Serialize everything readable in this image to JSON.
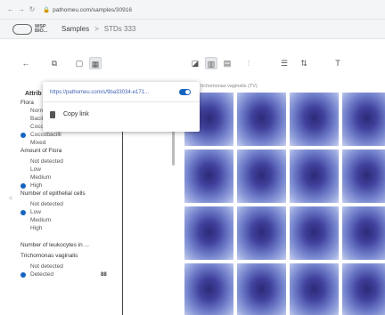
{
  "browser": {
    "url": "pathomeu.com/samples/30916",
    "back_icon": "arrow-left-icon",
    "forward_icon": "arrow-right-icon",
    "reload_icon": "reload-icon"
  },
  "header": {
    "logo_text": "WSP BIO...",
    "breadcrumb_root": "Samples",
    "breadcrumb_sep": ">",
    "breadcrumb_current": "STDs 333"
  },
  "toolbar": {
    "icons": [
      "back-arrow-icon",
      "share-icon",
      "document-icon",
      "grid-view-icon",
      "layout-a-icon",
      "layout-b-icon",
      "layout-c-icon",
      "column-icon",
      "filter-icon",
      "sort-icon",
      "text-size-icon"
    ]
  },
  "popup": {
    "share_url": "https://pathomeu.com/s/9ba33034-e171...",
    "copy_label": "Copy link"
  },
  "sidebar": {
    "heading": "Attrib",
    "items": [
      {
        "text": "Flora",
        "kind": "group"
      },
      {
        "text": "Normal",
        "kind": "opt"
      },
      {
        "text": "Bacilli",
        "kind": "opt"
      },
      {
        "text": "Cocci",
        "kind": "opt"
      },
      {
        "text": "Coccobacilli",
        "kind": "opt",
        "selected": true
      },
      {
        "text": "Mixed",
        "kind": "opt"
      },
      {
        "text": "Amount of Flora",
        "kind": "group"
      },
      {
        "text": "Not detected",
        "kind": "opt"
      },
      {
        "text": "Low",
        "kind": "opt"
      },
      {
        "text": "Medium",
        "kind": "opt"
      },
      {
        "text": "High",
        "kind": "opt",
        "selected": true
      },
      {
        "text": "Number of epithelial cells",
        "kind": "group"
      },
      {
        "text": "Not detected",
        "kind": "opt"
      },
      {
        "text": "Low",
        "kind": "opt",
        "selected": true
      },
      {
        "text": "Medium",
        "kind": "opt"
      },
      {
        "text": "High",
        "kind": "opt"
      },
      {
        "text": "Number of leukocytes in ...",
        "kind": "group"
      },
      {
        "text": "Trichomonas vaginalis",
        "kind": "group"
      },
      {
        "text": "Not detected",
        "kind": "opt"
      },
      {
        "text": "Detected",
        "kind": "opt",
        "selected": true
      }
    ],
    "small_button": "88",
    "nav_hint": "<"
  },
  "grid": {
    "label": "Trichomonas vaginalis (TV)",
    "tile_count": 16
  },
  "colors": {
    "accent": "#1565c0",
    "tile_stain_dark": "#2c2a78",
    "tile_stain_light": "#9aa8df"
  }
}
